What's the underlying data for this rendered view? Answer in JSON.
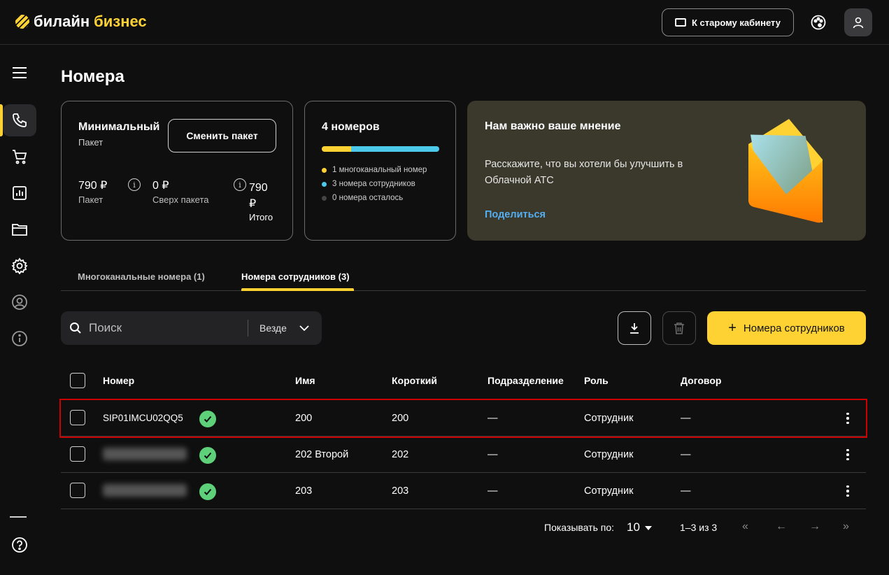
{
  "header": {
    "logo_main": "билайн",
    "logo_accent": "бизнес",
    "old_cabinet_label": "К старому кабинету"
  },
  "page": {
    "title": "Номера"
  },
  "package_card": {
    "name": "Минимальный",
    "subtitle": "Пакет",
    "change_button": "Сменить пакет",
    "package_price": "790 ₽",
    "package_price_label": "Пакет",
    "over_price": "0 ₽",
    "over_price_label": "Сверх пакета",
    "total_price": "790 ₽",
    "total_label": "Итого"
  },
  "numbers_card": {
    "title": "4 номеров",
    "progress": {
      "multichannel": 1,
      "employees": 3,
      "remaining": 0,
      "total": 4
    },
    "legend": [
      {
        "text": "1 многоканальный номер",
        "color": "#ffd233"
      },
      {
        "text": "3 номера сотрудников",
        "color": "#4cc9e8"
      },
      {
        "text": "0 номера осталось",
        "color": "#444444"
      }
    ]
  },
  "feedback_card": {
    "title": "Нам важно ваше мнение",
    "text": "Расскажите, что вы хотели бы улучшить в Облачной АТС",
    "link": "Поделиться"
  },
  "tabs": [
    {
      "label": "Многоканальные номера (1)",
      "active": false
    },
    {
      "label": "Номера сотрудников (3)",
      "active": true
    }
  ],
  "search": {
    "placeholder": "Поиск",
    "scope": "Везде"
  },
  "add_button": "Номера сотрудников",
  "table": {
    "columns": [
      "Номер",
      "Имя",
      "Короткий",
      "Подразделение",
      "Роль",
      "Договор"
    ],
    "rows": [
      {
        "number": "SIP01IMCU02QQ5",
        "name": "200",
        "short": "200",
        "department": "—",
        "role": "Сотрудник",
        "contract": "—"
      },
      {
        "number": "",
        "name": "202 Второй",
        "short": "202",
        "department": "—",
        "role": "Сотрудник",
        "contract": "—"
      },
      {
        "number": "",
        "name": "203",
        "short": "203",
        "department": "—",
        "role": "Сотрудник",
        "contract": "—"
      }
    ]
  },
  "pagination": {
    "show_label": "Показывать по:",
    "page_size": "10",
    "range": "1–3 из 3"
  },
  "colors": {
    "accent": "#ffd233",
    "success": "#5fd07a",
    "link": "#54aef0",
    "feedback_bg": "#3b382c"
  }
}
